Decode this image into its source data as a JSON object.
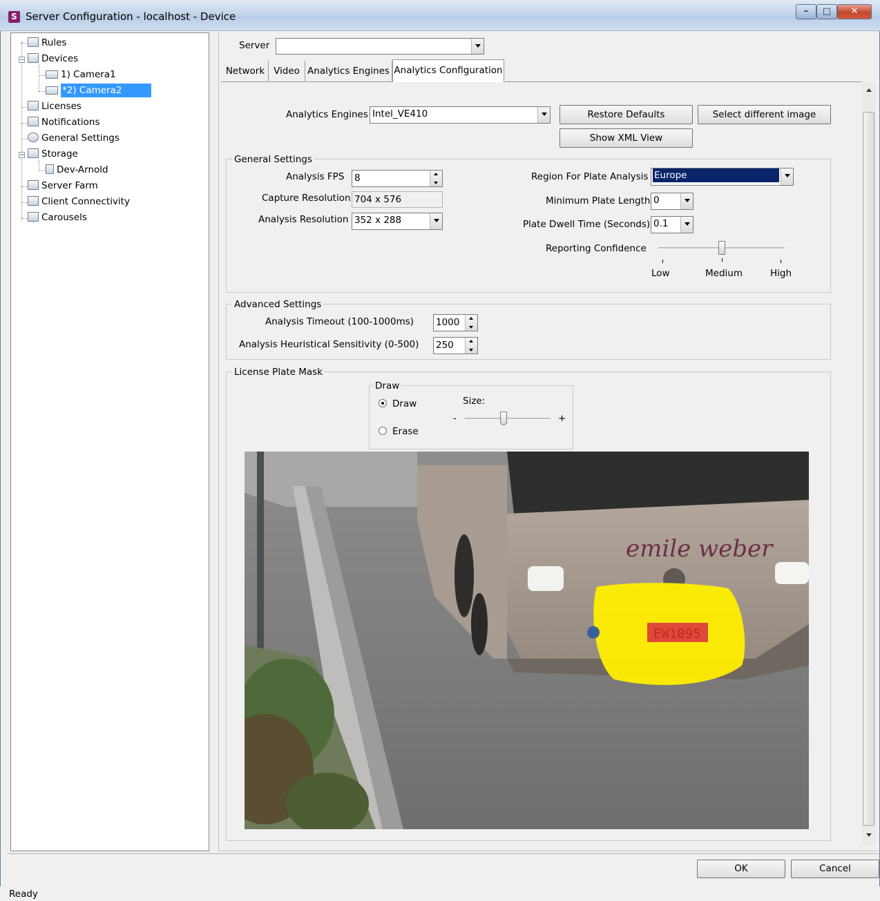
{
  "window": {
    "title": "Server Configuration - localhost - Device"
  },
  "tree": {
    "items": [
      {
        "label": "Rules",
        "icon": "rules-icon"
      },
      {
        "label": "Devices",
        "icon": "devices-icon"
      },
      {
        "label": "1) Camera1",
        "icon": "camera-icon"
      },
      {
        "label": "*2) Camera2",
        "icon": "camera-icon",
        "selected": true
      },
      {
        "label": "Licenses",
        "icon": "licenses-icon"
      },
      {
        "label": "Notifications",
        "icon": "notifications-icon"
      },
      {
        "label": "General Settings",
        "icon": "general-settings-icon"
      },
      {
        "label": "Storage",
        "icon": "storage-icon"
      },
      {
        "label": "Dev-Arnold",
        "icon": "storage-device-icon"
      },
      {
        "label": "Server Farm",
        "icon": "server-farm-icon"
      },
      {
        "label": "Client Connectivity",
        "icon": "client-connectivity-icon"
      },
      {
        "label": "Carousels",
        "icon": "carousels-icon"
      }
    ]
  },
  "server": {
    "label": "Server",
    "value": ""
  },
  "tabs": [
    "Network",
    "Video",
    "Analytics Engines",
    "Analytics Configuration"
  ],
  "engines": {
    "label": "Analytics Engines",
    "value": "Intel_VE410",
    "restore_defaults": "Restore Defaults",
    "select_image": "Select different image",
    "show_xml": "Show XML View"
  },
  "general": {
    "title": "General Settings",
    "fps_label": "Analysis FPS",
    "fps_value": "8",
    "capture_label": "Capture Resolution",
    "capture_value": "704 x 576",
    "analysis_res_label": "Analysis Resolution",
    "analysis_res_value": "352 x 288",
    "region_label": "Region For Plate Analysis",
    "region_value": "Europe",
    "min_plate_label": "Minimum Plate Length",
    "min_plate_value": "0",
    "dwell_label": "Plate Dwell Time (Seconds)",
    "dwell_value": "0.1",
    "confidence_label": "Reporting Confidence",
    "confidence_low": "Low",
    "confidence_medium": "Medium",
    "confidence_high": "High",
    "confidence_level": 0.5
  },
  "advanced": {
    "title": "Advanced Settings",
    "timeout_label": "Analysis Timeout (100-1000ms)",
    "timeout_value": "1000",
    "heuristic_label": "Analysis Heuristical Sensitivity (0-500)",
    "heuristic_value": "250"
  },
  "mask": {
    "title": "License Plate Mask",
    "draw_group": "Draw",
    "draw_option": "Draw",
    "erase_option": "Erase",
    "size_label": "Size:",
    "size_minus": "-",
    "size_plus": "+",
    "size_level": 0.45,
    "image_brand_text": "emile weber",
    "image_plate_text": "EW1095"
  },
  "buttons": {
    "ok": "OK",
    "cancel": "Cancel"
  },
  "status": {
    "text": "Ready"
  },
  "colors": {
    "selection": "#3399ff",
    "mask_yellow": "#ffee00",
    "region_highlight": "#0a246a"
  }
}
